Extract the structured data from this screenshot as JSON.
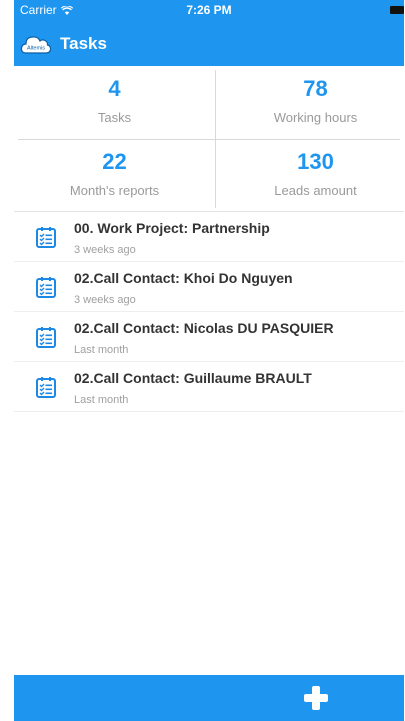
{
  "status_bar": {
    "carrier": "Carrier",
    "time": "7:26 PM"
  },
  "navbar": {
    "logo_icon": "altemis-cloud-logo",
    "logo_text": "Altemis",
    "title": "Tasks"
  },
  "stats": [
    {
      "value": "4",
      "label": "Tasks"
    },
    {
      "value": "78",
      "label": "Working hours"
    },
    {
      "value": "22",
      "label": "Month's reports"
    },
    {
      "value": "130",
      "label": "Leads amount"
    }
  ],
  "tasks": [
    {
      "title": "00. Work Project: Partnership",
      "time": "3 weeks ago",
      "icon": "checklist-icon"
    },
    {
      "title": "02.Call Contact: Khoi Do Nguyen",
      "time": "3 weeks ago",
      "icon": "checklist-icon"
    },
    {
      "title": "02.Call Contact: Nicolas DU PASQUIER",
      "time": "Last month",
      "icon": "checklist-icon"
    },
    {
      "title": "02.Call Contact: Guillaume BRAULT",
      "time": "Last month",
      "icon": "checklist-icon"
    }
  ],
  "bottom_bar": {
    "add_icon": "plus-icon"
  },
  "colors": {
    "primary": "#1e95ef",
    "stat_value": "#1e95ef",
    "label_gray": "#9a9a9a",
    "task_title": "#333333"
  }
}
